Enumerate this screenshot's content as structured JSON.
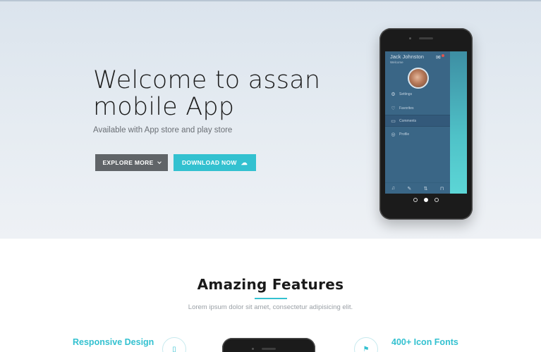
{
  "hero": {
    "title": "Welcome to assan mobile App",
    "subtitle": "Available with App store and play store",
    "explore_label": "EXPLORE MORE",
    "download_label": "DOWNLOAD NOW"
  },
  "phone_screen": {
    "user_name": "Jack Johnston",
    "greeting": "Welcome",
    "menu": [
      {
        "label": "Settings",
        "icon": "gear-icon"
      },
      {
        "label": "Favorites",
        "icon": "heart-icon"
      },
      {
        "label": "Comments",
        "icon": "comment-icon"
      },
      {
        "label": "Profile",
        "icon": "user-icon"
      }
    ],
    "active_item": "Comments"
  },
  "carousel": {
    "slides": 3,
    "active_index": 1
  },
  "features": {
    "title": "Amazing Features",
    "subtitle": "Lorem ipsum dolor sit amet, consectetur adipisicing elit.",
    "left_title": "Responsive Design",
    "right_title": "400+ Icon Fonts"
  },
  "colors": {
    "accent": "#33c1d0",
    "button_dark": "#606468",
    "screen_bg": "#3a6686"
  }
}
